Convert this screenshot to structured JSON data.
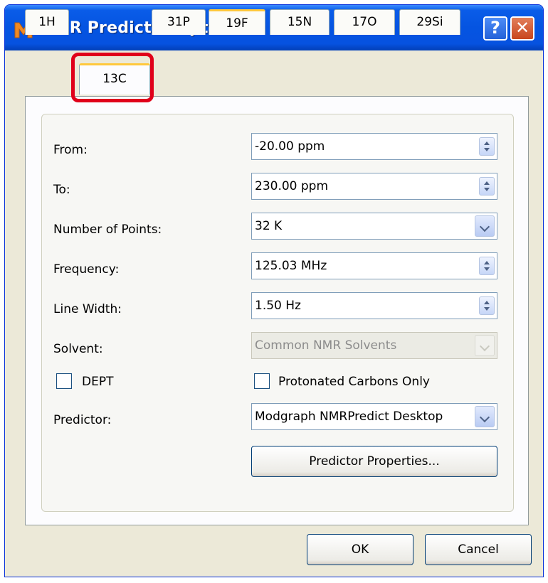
{
  "window": {
    "title": "NMR Predictor Options"
  },
  "titlebar": {
    "help_label": "?",
    "close_label": "✕"
  },
  "tabs": [
    {
      "label": "1H"
    },
    {
      "label": "13C"
    },
    {
      "label": "31P"
    },
    {
      "label": "19F"
    },
    {
      "label": "15N"
    },
    {
      "label": "17O"
    },
    {
      "label": "29Si"
    }
  ],
  "selected_tab": "13C",
  "form": {
    "from": {
      "label": "From:",
      "value": "-20.00 ppm"
    },
    "to": {
      "label": "To:",
      "value": "230.00 ppm"
    },
    "points": {
      "label": "Number of Points:",
      "value": "32 K"
    },
    "frequency": {
      "label": "Frequency:",
      "value": "125.03 MHz"
    },
    "line_width": {
      "label": "Line Width:",
      "value": "1.50 Hz"
    },
    "solvent": {
      "label": "Solvent:",
      "value": "Common NMR Solvents"
    },
    "dept": {
      "label": "DEPT",
      "checked": false
    },
    "protonated": {
      "label": "Protonated Carbons Only",
      "checked": false
    },
    "predictor": {
      "label": "Predictor:",
      "value": "Modgraph NMRPredict Desktop"
    },
    "predictor_properties_label": "Predictor Properties..."
  },
  "buttons": {
    "ok": "OK",
    "cancel": "Cancel"
  },
  "colors": {
    "titlebar": "#0554e1",
    "dialog_bg": "#ece9d8",
    "highlight": "#e0001a",
    "tab_accent": "#ffc83c"
  }
}
